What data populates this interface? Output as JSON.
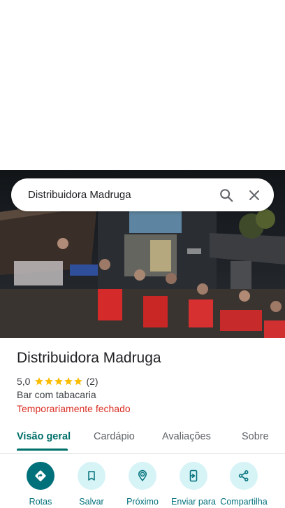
{
  "search": {
    "query": "Distribuidora Madruga"
  },
  "place": {
    "name": "Distribuidora Madruga",
    "rating": "5,0",
    "stars": 5,
    "review_count": "(2)",
    "category": "Bar com tabacaria",
    "status": "Temporariamente fechado"
  },
  "tabs": [
    {
      "label": "Visão geral"
    },
    {
      "label": "Cardápio"
    },
    {
      "label": "Avaliações"
    },
    {
      "label": "Sobre"
    }
  ],
  "actions": [
    {
      "label": "Rotas",
      "icon": "directions-icon"
    },
    {
      "label": "Salvar",
      "icon": "bookmark-icon"
    },
    {
      "label": "Próximo",
      "icon": "nearby-icon"
    },
    {
      "label": "Enviar para",
      "icon": "send-to-phone-icon"
    },
    {
      "label": "Compartilha",
      "icon": "share-icon"
    }
  ],
  "colors": {
    "accent": "#00706a",
    "action_bg": "#d6f3f6",
    "closed": "#d93025",
    "star": "#fbbc04"
  }
}
